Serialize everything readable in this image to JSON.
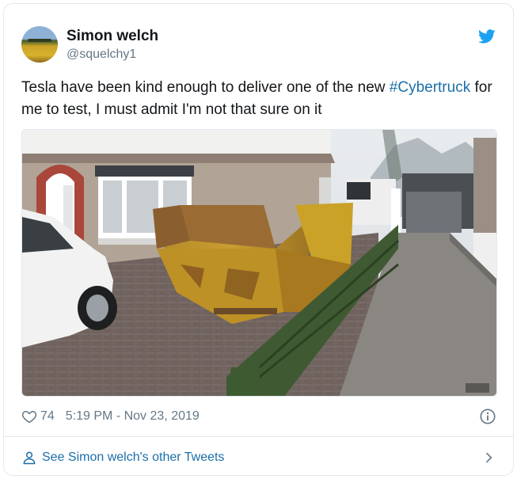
{
  "tweet": {
    "author": {
      "name": "Simon welch",
      "handle": "@squelchy1"
    },
    "text_before": "Tesla have been kind enough to deliver one of the new ",
    "hashtag": "#Cybertruck",
    "text_after": " for me to test, I must admit I'm not that sure on it",
    "likes": "74",
    "timestamp": "5:19 PM - Nov 23, 2019",
    "footer_link": "See Simon welch's other Tweets"
  },
  "icons": {
    "brand": "twitter-bird-icon",
    "like": "heart-icon",
    "info": "info-icon",
    "user": "user-icon",
    "chevron": "chevron-right-icon"
  },
  "colors": {
    "twitter_blue": "#1da1f2",
    "link_blue": "#1b6fa8",
    "muted": "#657786",
    "skip_yellow": "#c9a227"
  }
}
